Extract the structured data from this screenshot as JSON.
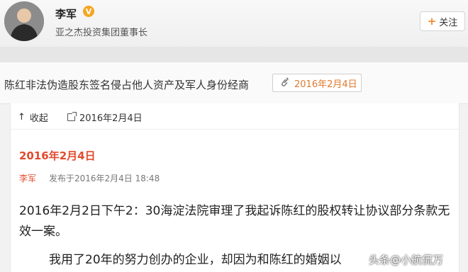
{
  "header": {
    "user_name": "李军",
    "verified_mark": "V",
    "bio": "亚之杰投资集团董事长",
    "follow_label": "关注",
    "follow_plus": "+"
  },
  "article": {
    "title": "陈红非法伪造股东签名侵占他人资产及军人身份经商",
    "date_tag": "2016年2月4日",
    "clip_glyph": "🔗"
  },
  "toolbar": {
    "collapse_label": "收起",
    "collapse_arrow": "↑",
    "source_date": "2016年2月4日"
  },
  "post": {
    "date_heading": "2016年2月4日",
    "author": "李军",
    "meta": "发布于2016年2月4日 18:48",
    "body": "2016年2月2日下午2：30海淀法院审理了我起诉陈红的股权转让协议部分条款无效一案。",
    "body_second": "我用了20年的努力创办的企业，却因为和陈红的婚姻以"
  },
  "watermark": "头条@小航侃万"
}
